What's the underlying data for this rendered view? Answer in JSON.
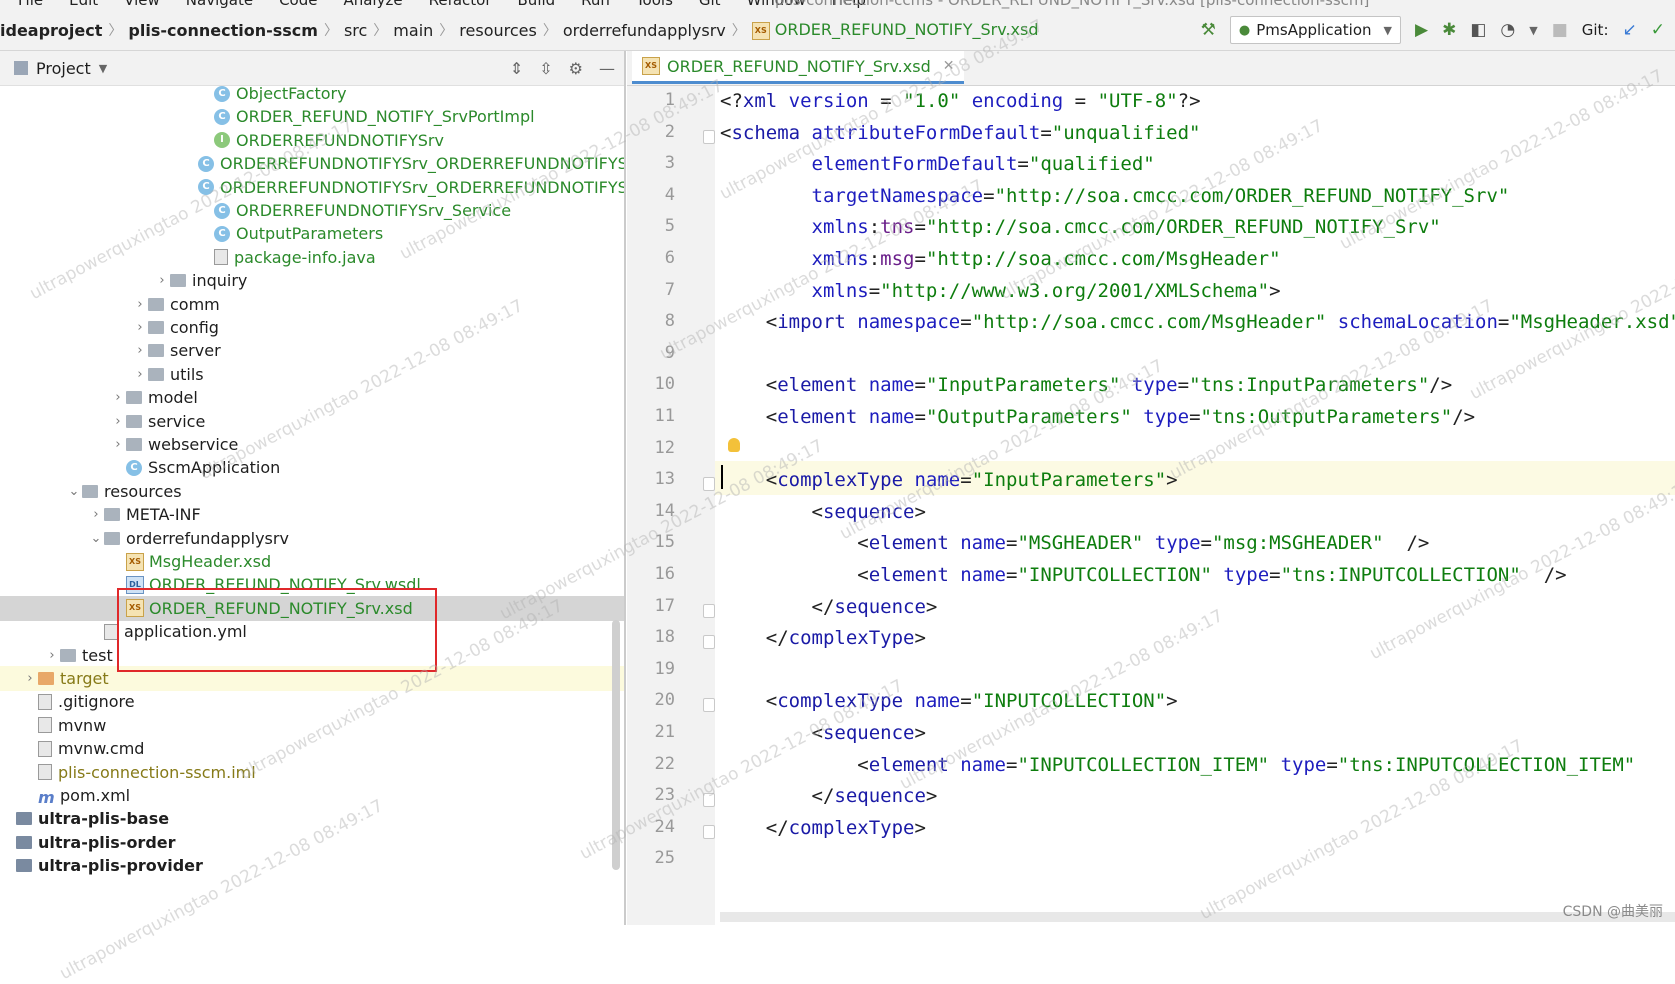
{
  "menu": [
    "File",
    "Edit",
    "View",
    "Navigate",
    "Code",
    "Analyze",
    "Refactor",
    "Build",
    "Run",
    "Tools",
    "Git",
    "Window",
    "Help"
  ],
  "window_title": "plis-connection-ccms - ORDER_REFUND_NOTIFY_Srv.xsd [plis-connection-sscm]",
  "breadcrumbs": [
    "ideaproject",
    "plis-connection-sscm",
    "src",
    "main",
    "resources",
    "orderrefundapplysrv",
    "ORDER_REFUND_NOTIFY_Srv.xsd"
  ],
  "run_config": "PmsApplication",
  "git_label": "Git:",
  "project_panel_title": "Project",
  "editor_tab": "ORDER_REFUND_NOTIFY_Srv.xsd",
  "tree": [
    {
      "label": "ObjectFactory",
      "indent": 222,
      "icon": "class",
      "color": "green",
      "arrow": ""
    },
    {
      "label": "ORDER_REFUND_NOTIFY_SrvPortImpl",
      "indent": 222,
      "icon": "class",
      "color": "green",
      "arrow": ""
    },
    {
      "label": "ORDERREFUNDNOTIFYSrv",
      "indent": 222,
      "icon": "intf",
      "color": "green",
      "arrow": ""
    },
    {
      "label": "ORDERREFUNDNOTIFYSrv_ORDERREFUNDNOTIFYSrvPort_Client",
      "indent": 222,
      "icon": "class",
      "color": "green",
      "arrow": ""
    },
    {
      "label": "ORDERREFUNDNOTIFYSrv_ORDERREFUNDNOTIFYSrvPort_Server",
      "indent": 222,
      "icon": "class",
      "color": "green",
      "arrow": ""
    },
    {
      "label": "ORDERREFUNDNOTIFYSrv_Service",
      "indent": 222,
      "icon": "class",
      "color": "green",
      "arrow": ""
    },
    {
      "label": "OutputParameters",
      "indent": 222,
      "icon": "class",
      "color": "green",
      "arrow": ""
    },
    {
      "label": "package-info.java",
      "indent": 222,
      "icon": "file",
      "color": "green",
      "arrow": ""
    },
    {
      "label": "inquiry",
      "indent": 178,
      "icon": "folder",
      "color": "",
      "arrow": "›"
    },
    {
      "label": "comm",
      "indent": 156,
      "icon": "folder",
      "color": "",
      "arrow": "›"
    },
    {
      "label": "config",
      "indent": 156,
      "icon": "folder",
      "color": "",
      "arrow": "›"
    },
    {
      "label": "server",
      "indent": 156,
      "icon": "folder",
      "color": "",
      "arrow": "›"
    },
    {
      "label": "utils",
      "indent": 156,
      "icon": "folder",
      "color": "",
      "arrow": "›"
    },
    {
      "label": "model",
      "indent": 134,
      "icon": "folder",
      "color": "",
      "arrow": "›"
    },
    {
      "label": "service",
      "indent": 134,
      "icon": "folder",
      "color": "",
      "arrow": "›"
    },
    {
      "label": "webservice",
      "indent": 134,
      "icon": "folder",
      "color": "",
      "arrow": "›"
    },
    {
      "label": "SscmApplication",
      "indent": 134,
      "icon": "class",
      "color": "",
      "arrow": ""
    },
    {
      "label": "resources",
      "indent": 90,
      "icon": "folder",
      "color": "",
      "arrow": "⌄"
    },
    {
      "label": "META-INF",
      "indent": 112,
      "icon": "folder",
      "color": "",
      "arrow": "›"
    },
    {
      "label": "orderrefundapplysrv",
      "indent": 112,
      "icon": "folder",
      "color": "",
      "arrow": "⌄"
    },
    {
      "label": "MsgHeader.xsd",
      "indent": 134,
      "icon": "xsd",
      "color": "green",
      "arrow": ""
    },
    {
      "label": "ORDER_REFUND_NOTIFY_Srv.wsdl",
      "indent": 134,
      "icon": "wsdl",
      "color": "green",
      "arrow": ""
    },
    {
      "label": "ORDER_REFUND_NOTIFY_Srv.xsd",
      "indent": 134,
      "icon": "xsd",
      "color": "green",
      "arrow": "",
      "selected": true
    },
    {
      "label": "application.yml",
      "indent": 112,
      "icon": "file",
      "color": "",
      "arrow": ""
    },
    {
      "label": "test",
      "indent": 68,
      "icon": "folder",
      "color": "",
      "arrow": "›"
    },
    {
      "label": "target",
      "indent": 46,
      "icon": "folder-o",
      "color": "olive",
      "arrow": "›",
      "hl": true
    },
    {
      "label": ".gitignore",
      "indent": 46,
      "icon": "file",
      "color": "",
      "arrow": ""
    },
    {
      "label": "mvnw",
      "indent": 46,
      "icon": "file",
      "color": "",
      "arrow": ""
    },
    {
      "label": "mvnw.cmd",
      "indent": 46,
      "icon": "file",
      "color": "",
      "arrow": ""
    },
    {
      "label": "plis-connection-sscm.iml",
      "indent": 46,
      "icon": "file",
      "color": "olive",
      "arrow": ""
    },
    {
      "label": "pom.xml",
      "indent": 46,
      "icon": "m",
      "color": "",
      "arrow": ""
    },
    {
      "label": "ultra-plis-base",
      "indent": 24,
      "icon": "mod",
      "color": "",
      "arrow": "",
      "bold": true
    },
    {
      "label": "ultra-plis-order",
      "indent": 24,
      "icon": "mod",
      "color": "",
      "arrow": "",
      "bold": true
    },
    {
      "label": "ultra-plis-provider",
      "indent": 24,
      "icon": "mod",
      "color": "",
      "arrow": "",
      "bold": true
    }
  ],
  "code_lines": [
    [
      [
        "t-pun",
        "<?"
      ],
      [
        "t-tag",
        "xml "
      ],
      [
        "t-attr",
        "version"
      ],
      [
        "t-pun",
        " = "
      ],
      [
        "t-val",
        "\"1.0\""
      ],
      [
        "t-pun",
        " "
      ],
      [
        "t-attr",
        "encoding"
      ],
      [
        "t-pun",
        " = "
      ],
      [
        "t-val",
        "\"UTF-8\""
      ],
      [
        "t-pun",
        "?>"
      ]
    ],
    [
      [
        "t-pun",
        "<"
      ],
      [
        "t-tag",
        "schema "
      ],
      [
        "t-attr",
        "attributeFormDefault"
      ],
      [
        "t-pun",
        "="
      ],
      [
        "t-val",
        "\"unqualified\""
      ]
    ],
    [
      [
        "t-pun",
        "        "
      ],
      [
        "t-attr",
        "elementFormDefault"
      ],
      [
        "t-pun",
        "="
      ],
      [
        "t-val",
        "\"qualified\""
      ]
    ],
    [
      [
        "t-pun",
        "        "
      ],
      [
        "t-attr",
        "targetNamespace"
      ],
      [
        "t-pun",
        "="
      ],
      [
        "t-val",
        "\"http://soa.cmcc.com/ORDER_REFUND_NOTIFY_Srv\""
      ]
    ],
    [
      [
        "t-pun",
        "        "
      ],
      [
        "t-attr",
        "xmlns"
      ],
      [
        "t-pun",
        ":"
      ],
      [
        "t-ns",
        "tns"
      ],
      [
        "t-pun",
        "="
      ],
      [
        "t-val",
        "\"http://soa.cmcc.com/ORDER_REFUND_NOTIFY_Srv\""
      ]
    ],
    [
      [
        "t-pun",
        "        "
      ],
      [
        "t-attr",
        "xmlns"
      ],
      [
        "t-pun",
        ":"
      ],
      [
        "t-ns",
        "msg"
      ],
      [
        "t-pun",
        "="
      ],
      [
        "t-val",
        "\"http://soa.cmcc.com/MsgHeader\""
      ]
    ],
    [
      [
        "t-pun",
        "        "
      ],
      [
        "t-attr",
        "xmlns"
      ],
      [
        "t-pun",
        "="
      ],
      [
        "t-val",
        "\"http://www.w3.org/2001/XMLSchema\""
      ],
      [
        "t-pun",
        ">"
      ]
    ],
    [
      [
        "t-pun",
        "    <"
      ],
      [
        "t-tag",
        "import "
      ],
      [
        "t-attr",
        "namespace"
      ],
      [
        "t-pun",
        "="
      ],
      [
        "t-val",
        "\"http://soa.cmcc.com/MsgHeader\""
      ],
      [
        "t-pun",
        " "
      ],
      [
        "t-attr",
        "schemaLocation"
      ],
      [
        "t-pun",
        "="
      ],
      [
        "t-val",
        "\"MsgHeader.xsd\""
      ],
      [
        "t-pun",
        "/>"
      ]
    ],
    [],
    [
      [
        "t-pun",
        "    <"
      ],
      [
        "t-tag",
        "element "
      ],
      [
        "t-attr",
        "name"
      ],
      [
        "t-pun",
        "="
      ],
      [
        "t-val",
        "\"InputParameters\""
      ],
      [
        "t-pun",
        " "
      ],
      [
        "t-attr",
        "type"
      ],
      [
        "t-pun",
        "="
      ],
      [
        "t-val",
        "\"tns:InputParameters\""
      ],
      [
        "t-pun",
        "/>"
      ]
    ],
    [
      [
        "t-pun",
        "    <"
      ],
      [
        "t-tag",
        "element "
      ],
      [
        "t-attr",
        "name"
      ],
      [
        "t-pun",
        "="
      ],
      [
        "t-val",
        "\"OutputParameters\""
      ],
      [
        "t-pun",
        " "
      ],
      [
        "t-attr",
        "type"
      ],
      [
        "t-pun",
        "="
      ],
      [
        "t-val",
        "\"tns:OutputParameters\""
      ],
      [
        "t-pun",
        "/>"
      ]
    ],
    [],
    [
      [
        "t-pun",
        "    <"
      ],
      [
        "t-tag",
        "complexType "
      ],
      [
        "t-attr",
        "name"
      ],
      [
        "t-pun",
        "="
      ],
      [
        "t-val",
        "\"InputParameters\""
      ],
      [
        "t-pun",
        ">"
      ]
    ],
    [
      [
        "t-pun",
        "        <"
      ],
      [
        "t-tag",
        "sequence"
      ],
      [
        "t-pun",
        ">"
      ]
    ],
    [
      [
        "t-pun",
        "            <"
      ],
      [
        "t-tag",
        "element "
      ],
      [
        "t-attr",
        "name"
      ],
      [
        "t-pun",
        "="
      ],
      [
        "t-val",
        "\"MSGHEADER\""
      ],
      [
        "t-pun",
        " "
      ],
      [
        "t-attr",
        "type"
      ],
      [
        "t-pun",
        "="
      ],
      [
        "t-val",
        "\"msg:MSGHEADER\""
      ],
      [
        "t-pun",
        "  />"
      ]
    ],
    [
      [
        "t-pun",
        "            <"
      ],
      [
        "t-tag",
        "element "
      ],
      [
        "t-attr",
        "name"
      ],
      [
        "t-pun",
        "="
      ],
      [
        "t-val",
        "\"INPUTCOLLECTION\""
      ],
      [
        "t-pun",
        " "
      ],
      [
        "t-attr",
        "type"
      ],
      [
        "t-pun",
        "="
      ],
      [
        "t-val",
        "\"tns:INPUTCOLLECTION\""
      ],
      [
        "t-pun",
        "  />"
      ]
    ],
    [
      [
        "t-pun",
        "        </"
      ],
      [
        "t-tag",
        "sequence"
      ],
      [
        "t-pun",
        ">"
      ]
    ],
    [
      [
        "t-pun",
        "    </"
      ],
      [
        "t-tag",
        "complexType"
      ],
      [
        "t-pun",
        ">"
      ]
    ],
    [],
    [
      [
        "t-pun",
        "    <"
      ],
      [
        "t-tag",
        "complexType "
      ],
      [
        "t-attr",
        "name"
      ],
      [
        "t-pun",
        "="
      ],
      [
        "t-val",
        "\"INPUTCOLLECTION\""
      ],
      [
        "t-pun",
        ">"
      ]
    ],
    [
      [
        "t-pun",
        "        <"
      ],
      [
        "t-tag",
        "sequence"
      ],
      [
        "t-pun",
        ">"
      ]
    ],
    [
      [
        "t-pun",
        "            <"
      ],
      [
        "t-tag",
        "element "
      ],
      [
        "t-attr",
        "name"
      ],
      [
        "t-pun",
        "="
      ],
      [
        "t-val",
        "\"INPUTCOLLECTION_ITEM\""
      ],
      [
        "t-pun",
        " "
      ],
      [
        "t-attr",
        "type"
      ],
      [
        "t-pun",
        "="
      ],
      [
        "t-val",
        "\"tns:INPUTCOLLECTION_ITEM\""
      ]
    ],
    [
      [
        "t-pun",
        "        </"
      ],
      [
        "t-tag",
        "sequence"
      ],
      [
        "t-pun",
        ">"
      ]
    ],
    [
      [
        "t-pun",
        "    </"
      ],
      [
        "t-tag",
        "complexType"
      ],
      [
        "t-pun",
        ">"
      ]
    ],
    []
  ],
  "watermark_text": "ultrapowerquxingtao 2022-12-08 08:49:17",
  "csdn_credit": "CSDN @曲美丽"
}
